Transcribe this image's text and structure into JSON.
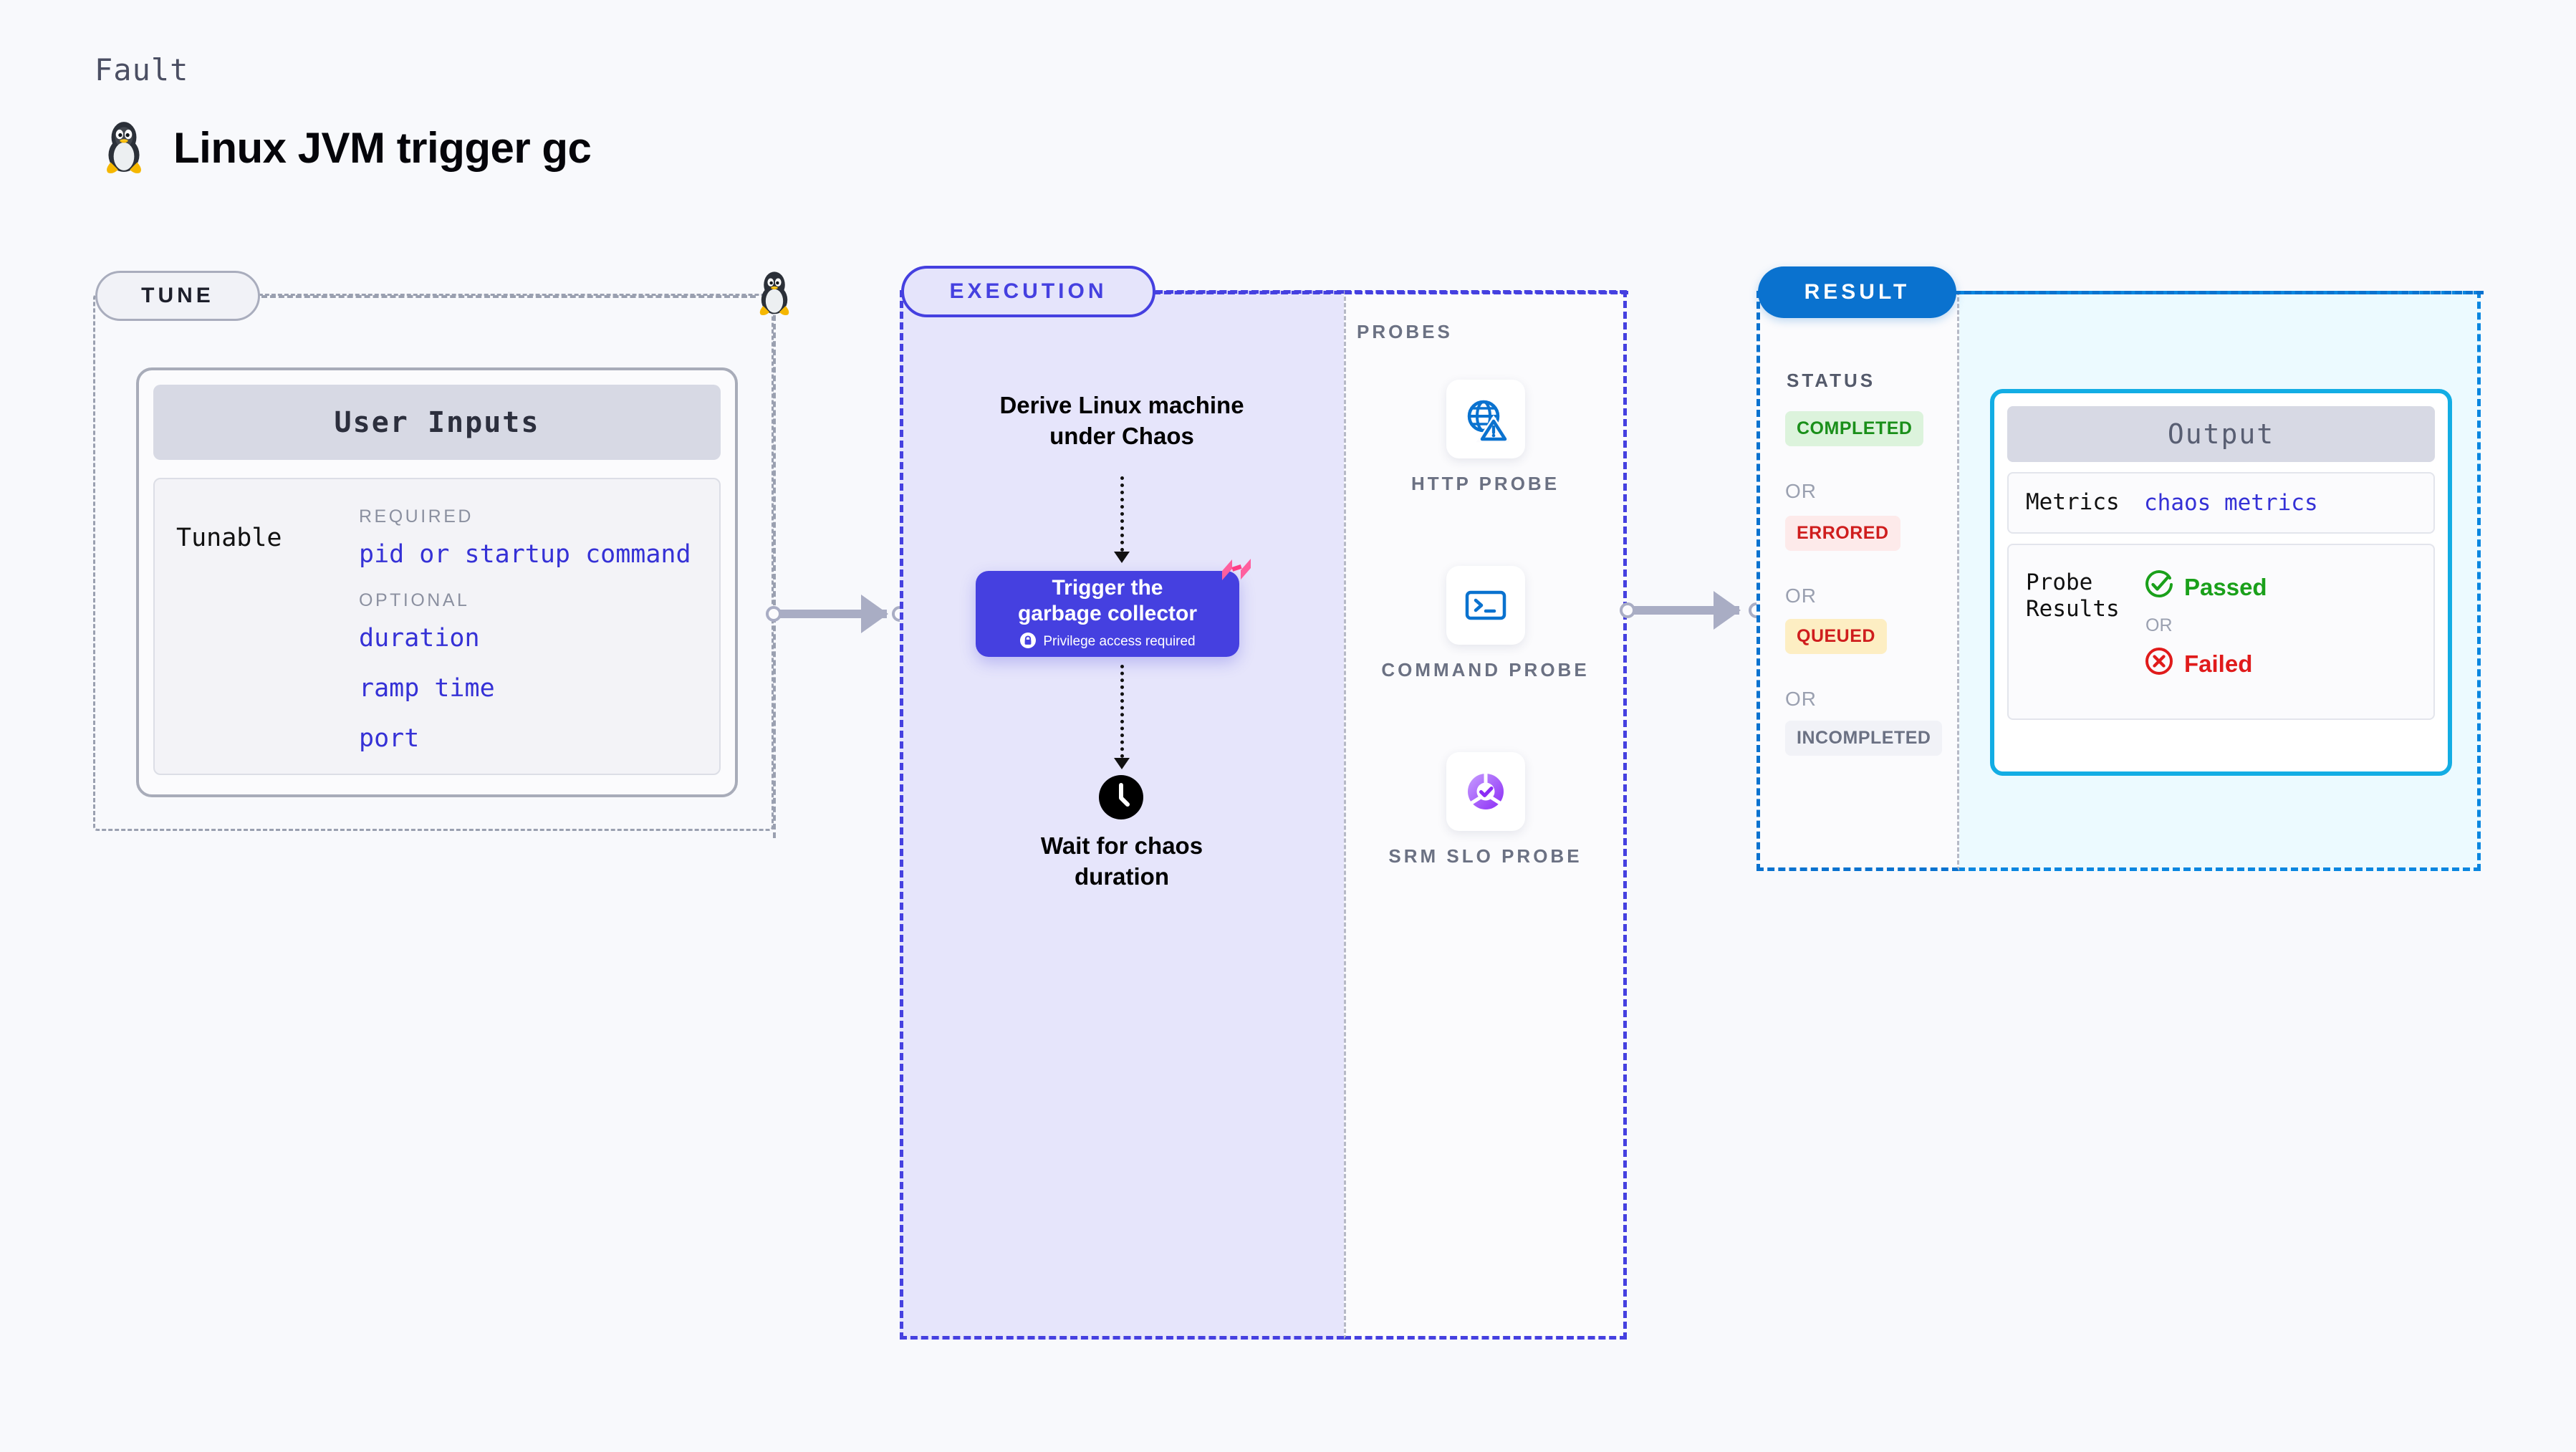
{
  "header": {
    "eyebrow": "Fault",
    "title": "Linux JVM trigger gc",
    "icon": "linux-penguin-icon"
  },
  "tune": {
    "pill_label": "TUNE",
    "card_title": "User Inputs",
    "tunable_label": "Tunable",
    "required_label": "REQUIRED",
    "optional_label": "OPTIONAL",
    "required_items": [
      "pid or startup command"
    ],
    "optional_items": [
      "duration",
      "ramp time",
      "port"
    ],
    "link_color": "#3531d6"
  },
  "execution": {
    "pill_label": "EXECUTION",
    "step_derive": "Derive Linux machine\nunder Chaos",
    "action_title": "Trigger the\ngarbage collector",
    "action_subtitle": "Privilege access required",
    "action_icon": "lock-icon",
    "badge_icon": "harness-logo-icon",
    "wait_icon": "clock-icon",
    "step_wait": "Wait for chaos\nduration",
    "accent_color": "#4540e0",
    "panel_bg": "#e6e5fb"
  },
  "probes": {
    "section_label": "PROBES",
    "items": [
      {
        "label": "HTTP PROBE",
        "icon": "globe-warning-icon",
        "color": "#0a72cf"
      },
      {
        "label": "COMMAND PROBE",
        "icon": "terminal-icon",
        "color": "#0a72cf"
      },
      {
        "label": "SRM SLO PROBE",
        "icon": "slo-donut-check-icon",
        "color": "#9b4dff"
      }
    ]
  },
  "result": {
    "pill_label": "RESULT",
    "status_label": "STATUS",
    "or_label": "OR",
    "badges": [
      {
        "label": "COMPLETED",
        "bg": "#dcf3dc",
        "fg": "#1a8f1a"
      },
      {
        "label": "ERRORED",
        "bg": "#fdeaea",
        "fg": "#cf1d1d"
      },
      {
        "label": "QUEUED",
        "bg": "#fdeec3",
        "fg": "#cf1d1d"
      },
      {
        "label": "INCOMPLETED",
        "bg": "#f1f2f7",
        "fg": "#6b7183"
      }
    ],
    "accent_color": "#0a72cf"
  },
  "output": {
    "card_title": "Output",
    "metrics_key": "Metrics",
    "metrics_value": "chaos metrics",
    "probe_results_key": "Probe\nResults",
    "passed_label": "Passed",
    "passed_icon": "check-circle-icon",
    "passed_color": "#1aa01a",
    "or_label": "OR",
    "failed_label": "Failed",
    "failed_icon": "x-circle-icon",
    "failed_color": "#e01b1b",
    "border_color": "#13ade4",
    "panel_bg": "#ecfaff"
  }
}
